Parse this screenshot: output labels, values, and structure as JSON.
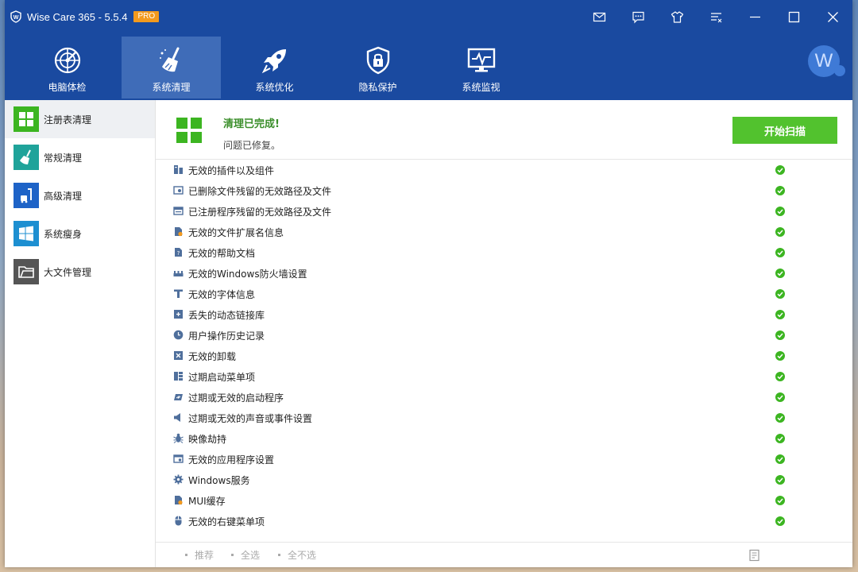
{
  "titlebar": {
    "app_title": "Wise Care 365 - 5.5.4",
    "badge": "PRO",
    "tools": [
      "mail-icon",
      "feedback-icon",
      "skin-icon",
      "menu-icon",
      "minimize-icon",
      "maximize-icon",
      "close-icon"
    ]
  },
  "nav": {
    "items": [
      {
        "label": "电脑体检",
        "icon": "radar-icon",
        "active": false
      },
      {
        "label": "系统清理",
        "icon": "broom-icon",
        "active": true
      },
      {
        "label": "系统优化",
        "icon": "rocket-icon",
        "active": false
      },
      {
        "label": "隐私保护",
        "icon": "lock-shield-icon",
        "active": false
      },
      {
        "label": "系统监视",
        "icon": "monitor-icon",
        "active": false
      }
    ],
    "avatar_letter": "W"
  },
  "sidebar": {
    "items": [
      {
        "label": "注册表清理",
        "icon": "registry-icon",
        "color": "#3cb521",
        "active": true
      },
      {
        "label": "常规清理",
        "icon": "broom-icon",
        "color": "#1fa39a",
        "active": false
      },
      {
        "label": "高级清理",
        "icon": "vacuum-icon",
        "color": "#1e63c7",
        "active": false
      },
      {
        "label": "系统瘦身",
        "icon": "windows-icon",
        "color": "#1d8fd1",
        "active": false
      },
      {
        "label": "大文件管理",
        "icon": "folder-icon",
        "color": "#555555",
        "active": false
      }
    ]
  },
  "main": {
    "status_title": "清理已完成!",
    "status_sub": "问题已修复。",
    "scan_button": "开始扫描",
    "rows": [
      {
        "label": "无效的插件以及组件",
        "icon": "component-icon"
      },
      {
        "label": "已删除文件残留的无效路径及文件",
        "icon": "file-path-icon"
      },
      {
        "label": "已注册程序残留的无效路径及文件",
        "icon": "program-path-icon"
      },
      {
        "label": "无效的文件扩展名信息",
        "icon": "file-ext-icon"
      },
      {
        "label": "无效的帮助文档",
        "icon": "help-doc-icon"
      },
      {
        "label": "无效的Windows防火墙设置",
        "icon": "firewall-icon"
      },
      {
        "label": "无效的字体信息",
        "icon": "font-icon"
      },
      {
        "label": "丢失的动态链接库",
        "icon": "dll-icon"
      },
      {
        "label": "用户操作历史记录",
        "icon": "history-icon"
      },
      {
        "label": "无效的卸载",
        "icon": "uninstall-icon"
      },
      {
        "label": "过期启动菜单项",
        "icon": "start-menu-icon"
      },
      {
        "label": "过期或无效的启动程序",
        "icon": "startup-icon"
      },
      {
        "label": "过期或无效的声音或事件设置",
        "icon": "sound-icon"
      },
      {
        "label": "映像劫持",
        "icon": "bug-icon"
      },
      {
        "label": "无效的应用程序设置",
        "icon": "app-settings-icon"
      },
      {
        "label": "Windows服务",
        "icon": "service-icon"
      },
      {
        "label": "MUI缓存",
        "icon": "mui-cache-icon"
      },
      {
        "label": "无效的右键菜单项",
        "icon": "mouse-icon"
      }
    ],
    "footer": {
      "recommend": "推荐",
      "select_all": "全选",
      "select_none": "全不选"
    }
  },
  "colors": {
    "brand_blue": "#1a4aa0",
    "active_nav": "#3f6cb8",
    "accent_green": "#52c22e",
    "status_green": "#3a8e2a",
    "check_green": "#3cb521"
  }
}
